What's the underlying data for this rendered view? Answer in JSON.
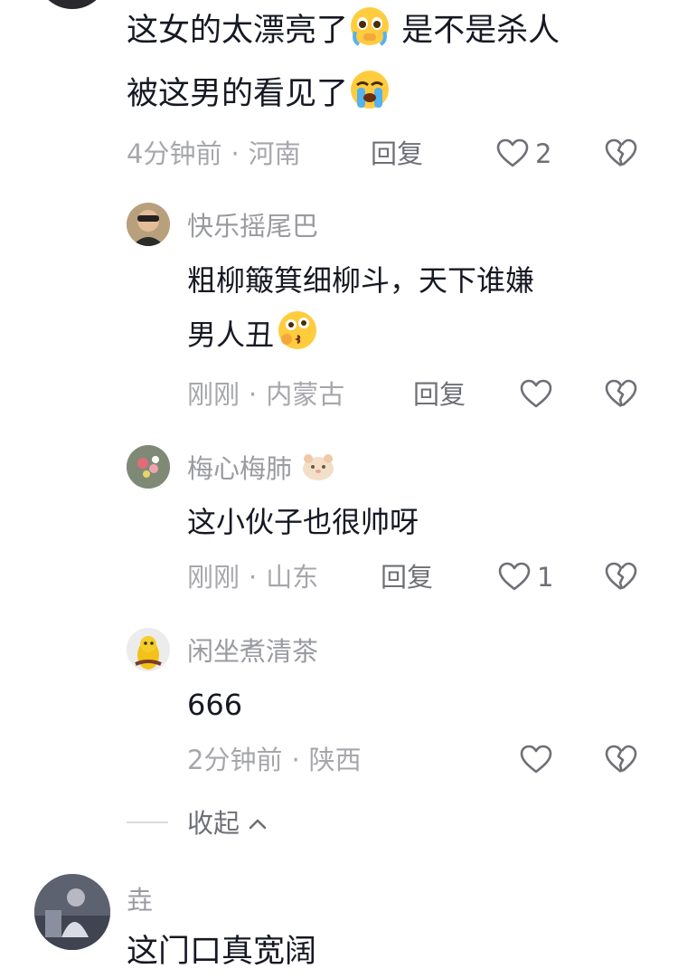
{
  "comments": [
    {
      "text_line1": "这女的太漂亮了",
      "text_line1b": " 是不是杀人",
      "text_line2": "被这男的看见了",
      "time": "4分钟前",
      "location": "河南",
      "reply_label": "回复",
      "likes": "2",
      "emoji_1": "pleading-face-emoji",
      "emoji_2": "loudly-crying-face-emoji",
      "replies": [
        {
          "username": "快乐摇尾巴",
          "text_line1": "粗柳簸箕细柳斗，天下谁嫌",
          "text_line2": "男人丑",
          "emoji": "kissing-face-emoji",
          "time": "刚刚",
          "location": "内蒙古",
          "reply_label": "回复"
        },
        {
          "username": "梅心梅肺",
          "text": "这小伙子也很帅呀",
          "time": "刚刚",
          "location": "山东",
          "reply_label": "回复",
          "likes": "1"
        },
        {
          "username": "闲坐煮清茶",
          "text": "666",
          "time": "2分钟前",
          "location": "陕西"
        }
      ],
      "collapse_label": "收起"
    },
    {
      "username": "垚",
      "text": "这门口真宽阔"
    }
  ],
  "colors": {
    "text": "#161823",
    "meta": "#a6a7ab",
    "icon": "#6f7076"
  }
}
